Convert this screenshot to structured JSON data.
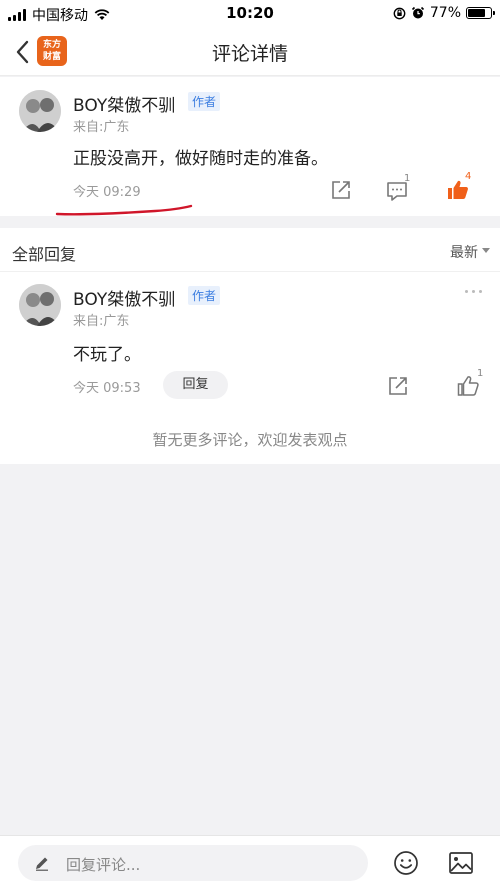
{
  "status_bar": {
    "carrier": "中国移动",
    "time": "10:20",
    "battery_percent": "77%",
    "battery_level": 0.77,
    "icons": [
      "signal-icon",
      "wifi-icon",
      "lock-rotation-icon",
      "alarm-icon",
      "battery-icon"
    ]
  },
  "nav": {
    "title": "评论详情",
    "logo_text_line1": "东方",
    "logo_text_line2": "财富",
    "brand_color": "#e8641b"
  },
  "main_comment": {
    "username": "BOY桀傲不驯",
    "badge": "作者",
    "location": "来自:广东",
    "content": "正股没高开，做好随时走的准备。",
    "time": "今天 09:29",
    "reply_count": "1",
    "like_count": "4",
    "liked": true,
    "like_color": "#f0601a"
  },
  "replies_section": {
    "title": "全部回复",
    "sort_label": "最新"
  },
  "replies": [
    {
      "username": "BOY桀傲不驯",
      "badge": "作者",
      "location": "来自:广东",
      "content": "不玩了。",
      "time": "今天 09:53",
      "reply_button": "回复",
      "like_count": "1"
    }
  ],
  "empty_hint": "暂无更多评论，欢迎发表观点",
  "composer": {
    "placeholder": "回复评论..."
  },
  "annotation_color": "#d0162a"
}
